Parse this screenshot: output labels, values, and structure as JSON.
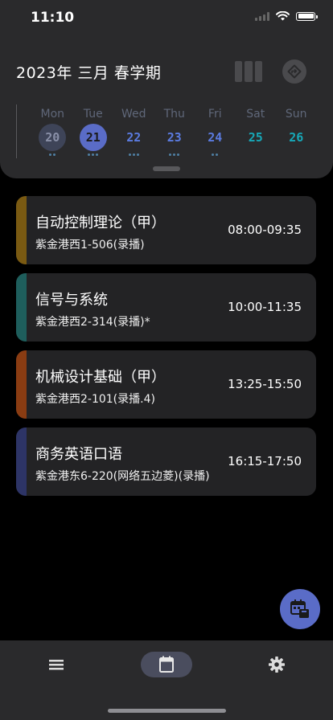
{
  "status_bar": {
    "time": "11:10"
  },
  "header": {
    "term_title": "2023年 三月 春学期"
  },
  "week": [
    {
      "day": "Mon",
      "date": "20",
      "dots": 2,
      "state": "past"
    },
    {
      "day": "Tue",
      "date": "21",
      "dots": 3,
      "state": "selected"
    },
    {
      "day": "Wed",
      "date": "22",
      "dots": 3,
      "state": "normal"
    },
    {
      "day": "Thu",
      "date": "23",
      "dots": 3,
      "state": "normal"
    },
    {
      "day": "Fri",
      "date": "24",
      "dots": 2,
      "state": "normal"
    },
    {
      "day": "Sat",
      "date": "25",
      "dots": 0,
      "state": "weekend"
    },
    {
      "day": "Sun",
      "date": "26",
      "dots": 0,
      "state": "weekend"
    }
  ],
  "courses": [
    {
      "name": "自动控制理论（甲）",
      "location": "紫金港西1-506(录播)",
      "time": "08:00-09:35",
      "color": "#7a5a12"
    },
    {
      "name": "信号与系统",
      "location": "紫金港西2-314(录播)*",
      "time": "10:00-11:35",
      "color": "#1e5e5c"
    },
    {
      "name": "机械设计基础（甲）",
      "location": "紫金港西2-101(录播.4)",
      "time": "13:25-15:50",
      "color": "#8a3c12"
    },
    {
      "name": "商务英语口语",
      "location": "紫金港东6-220(网络五边菱)(录播)",
      "time": "16:15-17:50",
      "color": "#2d3466"
    }
  ],
  "colors": {
    "accent": "#5a6cc7",
    "weekday_date": "#5b7be0",
    "weekend_date": "#17a8b8",
    "past_circle": "#3e4458",
    "selected_circle": "#5a6cc7",
    "panel": "#2a2a2c",
    "card": "#232325"
  },
  "icons": {
    "view_toggle": "grid-view-icon",
    "today": "today-arrow-icon",
    "fab": "calendar-add-icon",
    "nav_list": "list-icon",
    "nav_calendar": "calendar-icon",
    "nav_settings": "gear-icon"
  }
}
